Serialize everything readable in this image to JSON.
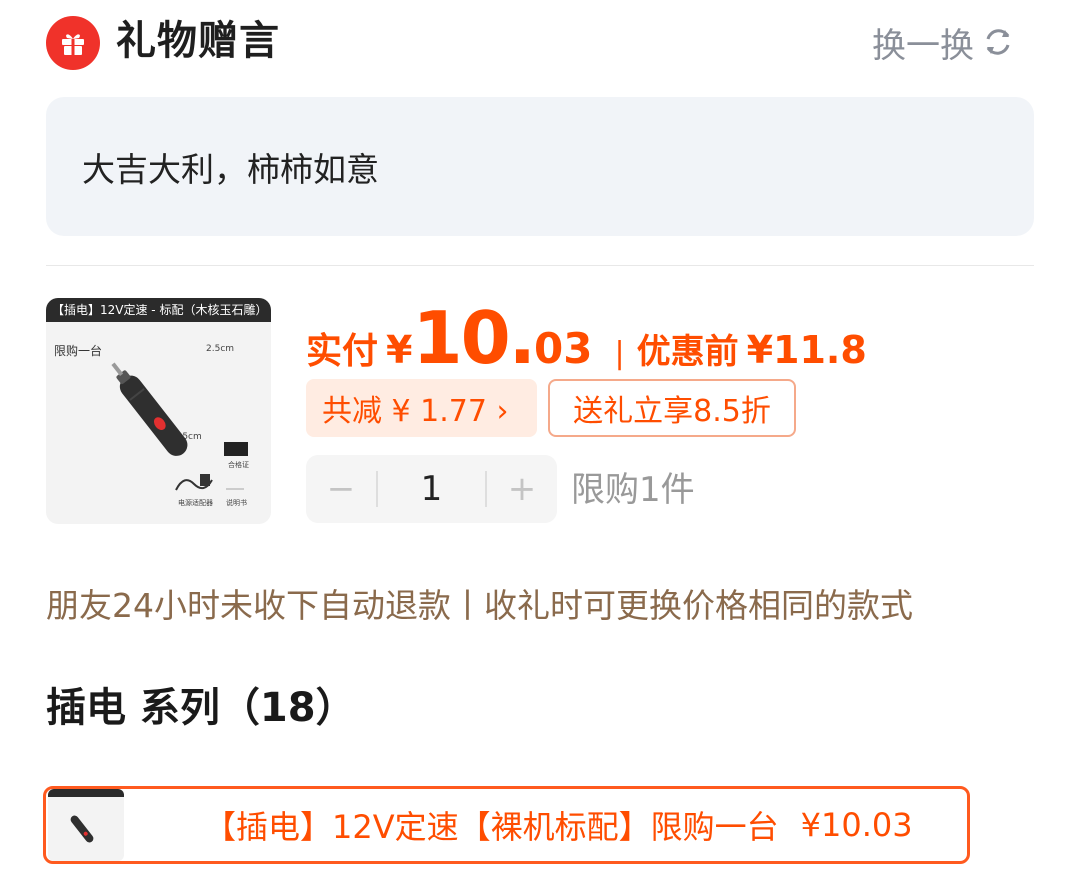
{
  "header": {
    "title": "礼物赠言",
    "refresh_label": "换一换"
  },
  "message": {
    "text": "大吉大利，柿柿如意"
  },
  "product": {
    "image_tag": "【插电】12V定速 - 标配（木核玉石雕）",
    "image_labels": {
      "limit": "限购一台",
      "dim_top": "2.5cm",
      "dim_length": "15.5cm",
      "adapter": "电源适配器",
      "certificate": "合格证",
      "manual": "说明书"
    },
    "pay_label": "实付",
    "currency": "¥",
    "price_int": "10.",
    "price_dec": "03",
    "separator": "|",
    "before_label": "优惠前",
    "before_price": "¥11.8",
    "discount_label": "共减 ¥ 1.77 ›",
    "gift_discount_label": "送礼立享8.5折",
    "quantity": "1",
    "minus": "−",
    "plus": "+",
    "limit_text": "限购1件"
  },
  "notice": "朋友24小时未收下自动退款丨收礼时可更换价格相同的款式",
  "series": {
    "title": "插电 系列（18）"
  },
  "sku": {
    "label": "【插电】12V定速【裸机标配】限购一台",
    "price": "¥10.03"
  },
  "colors": {
    "accent": "#ff4d00",
    "gift_red": "#f0322a",
    "msg_bg": "#f1f4f8",
    "notice": "#8a6a4c"
  }
}
